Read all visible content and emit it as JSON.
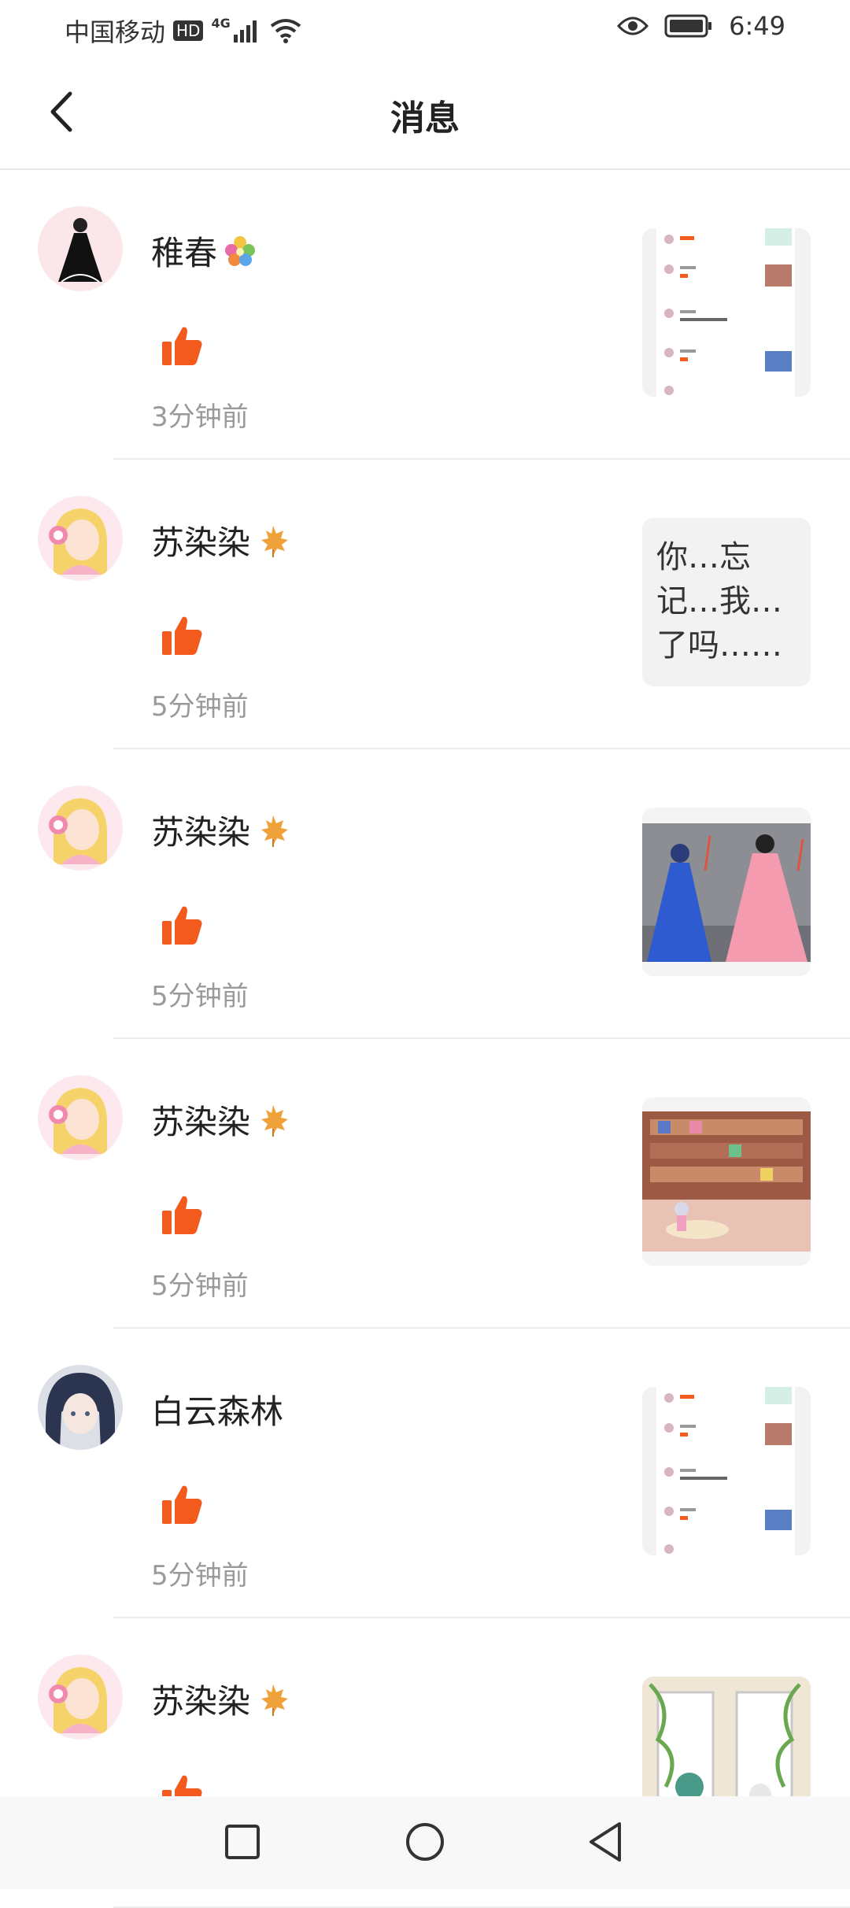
{
  "status_bar": {
    "carrier": "中国移动",
    "hd_label": "HD",
    "network": "4G",
    "time": "6:49"
  },
  "header": {
    "title": "消息"
  },
  "messages": [
    {
      "user": "稚春",
      "badge_icon": "flower-emoji",
      "time": "3分钟前",
      "thumb_type": "screenshot",
      "thumb_text": ""
    },
    {
      "user": "苏染染",
      "badge_icon": "maple-leaf",
      "time": "5分钟前",
      "thumb_type": "text",
      "thumb_text": "你…忘记…我…了吗……"
    },
    {
      "user": "苏染染",
      "badge_icon": "maple-leaf",
      "time": "5分钟前",
      "thumb_type": "image-dolls",
      "thumb_text": ""
    },
    {
      "user": "苏染染",
      "badge_icon": "maple-leaf",
      "time": "5分钟前",
      "thumb_type": "image-room",
      "thumb_text": ""
    },
    {
      "user": "白云森林",
      "badge_icon": "",
      "time": "5分钟前",
      "thumb_type": "screenshot",
      "thumb_text": ""
    },
    {
      "user": "苏染染",
      "badge_icon": "maple-leaf",
      "time": "",
      "thumb_type": "image-plants",
      "thumb_text": ""
    }
  ],
  "colors": {
    "like": "#F25A1E",
    "text_secondary": "#9A9A9A",
    "divider": "#ECECEC"
  }
}
